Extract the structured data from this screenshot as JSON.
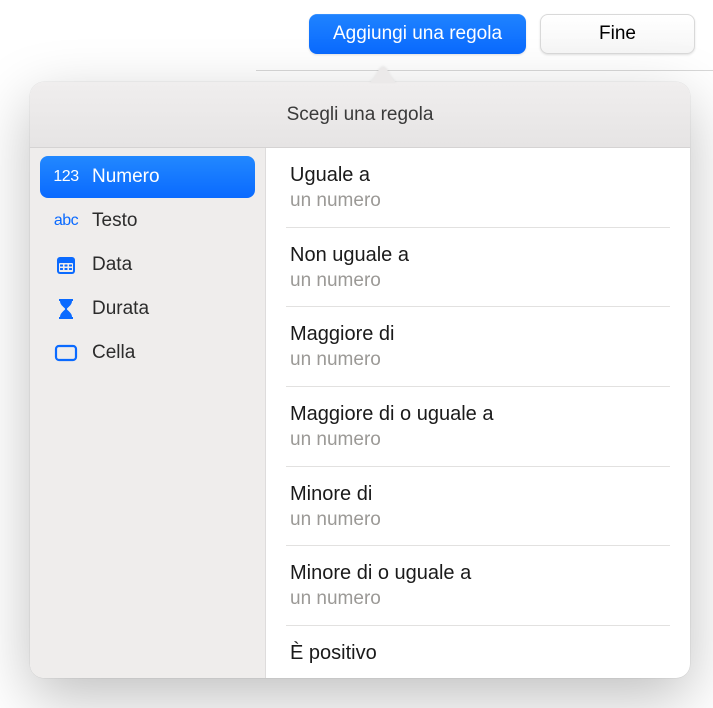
{
  "toolbar": {
    "add_rule_label": "Aggiungi una regola",
    "done_label": "Fine"
  },
  "popover": {
    "title": "Scegli una regola"
  },
  "sidebar": {
    "items": [
      {
        "id": "number",
        "label": "Numero",
        "icon": "number-icon",
        "selected": true
      },
      {
        "id": "text",
        "label": "Testo",
        "icon": "text-icon",
        "selected": false
      },
      {
        "id": "date",
        "label": "Data",
        "icon": "calendar-icon",
        "selected": false
      },
      {
        "id": "duration",
        "label": "Durata",
        "icon": "hourglass-icon",
        "selected": false
      },
      {
        "id": "cell",
        "label": "Cella",
        "icon": "cell-icon",
        "selected": false
      }
    ]
  },
  "rules": [
    {
      "title": "Uguale a",
      "subtitle": "un numero"
    },
    {
      "title": "Non uguale a",
      "subtitle": "un numero"
    },
    {
      "title": "Maggiore di",
      "subtitle": "un numero"
    },
    {
      "title": "Maggiore di o uguale a",
      "subtitle": "un numero"
    },
    {
      "title": "Minore di",
      "subtitle": "un numero"
    },
    {
      "title": "Minore di o uguale a",
      "subtitle": "un numero"
    },
    {
      "title": "È positivo",
      "subtitle": ""
    }
  ],
  "icon_glyphs": {
    "number-icon": "123",
    "text-icon": "abc"
  }
}
